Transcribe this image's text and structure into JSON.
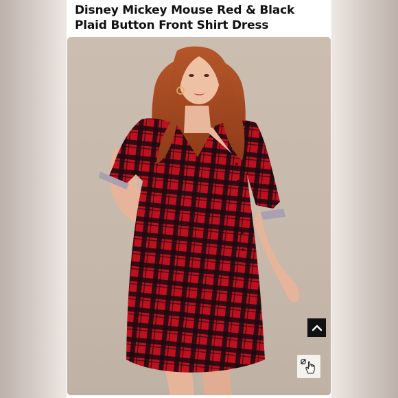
{
  "product": {
    "title_line1": "Disney Mickey Mouse Red & Black",
    "title_line2": "Plaid Button Front Shirt Dress"
  },
  "image": {
    "subject": "model wearing red and black plaid button front shirt dress",
    "colors": {
      "plaid_red": "#c0101f",
      "plaid_black": "#1a0b10",
      "background": "#c6b8aa"
    }
  },
  "controls": {
    "scroll_top_icon": "chevron-up-icon",
    "zoom_icon": "hand-pointer-expand-icon"
  }
}
